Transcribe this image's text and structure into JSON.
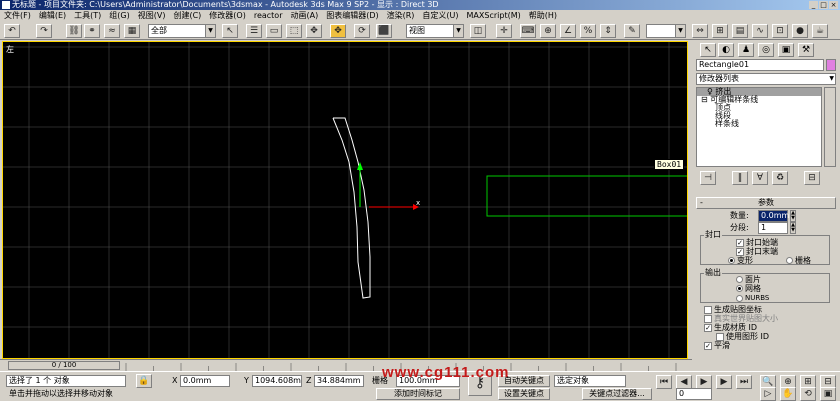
{
  "titlebar": {
    "title": "无标题    - 项目文件夹: C:\\Users\\Administrator\\Documents\\3dsmax    - Autodesk 3ds Max 9 SP2    - 显示 : Direct 3D",
    "buttons": [
      "_",
      "□",
      "×"
    ]
  },
  "menu": [
    "文件(F)",
    "编辑(E)",
    "工具(T)",
    "组(G)",
    "视图(V)",
    "创建(C)",
    "修改器(O)",
    "reactor",
    "动画(A)",
    "图表编辑器(D)",
    "渲染(R)",
    "自定义(U)",
    "MAXScript(M)",
    "帮助(H)"
  ],
  "toolbar": {
    "selection_filter": "全部",
    "coord_system": "视图"
  },
  "viewport": {
    "label": "左",
    "tooltip": "Box01",
    "colors": {
      "grid": "#555555",
      "bg": "#000000",
      "shape": "#ffffff",
      "rect": "#00c800",
      "axis_x": "#ff0000",
      "axis_y": "#00ff00"
    }
  },
  "rightpanel": {
    "object_name": "Rectangle01",
    "modifier_list": "修改器列表",
    "stack": [
      "挤出",
      "可编辑样条线",
      "顶点",
      "线段",
      "样条线"
    ],
    "params_title": "参数",
    "amount_label": "数量:",
    "amount_value": "0.0mm",
    "segments_label": "分段:",
    "segments_value": "1",
    "capping_title": "封口",
    "cap_start": "封口始端",
    "cap_end": "封口末端",
    "morph": "变形",
    "grid": "栅格",
    "output_title": "输出",
    "patch": "面片",
    "mesh": "网格",
    "nurbs": "NURBS",
    "gen_mapping": "生成贴图坐标",
    "real_world": "真实世界贴图大小",
    "gen_matid": "生成材质 ID",
    "use_shape_id": "使用图形 ID",
    "smooth": "平滑"
  },
  "timeline": {
    "slider": "0 / 100"
  },
  "status": {
    "selected": "选择了 1 个 对象",
    "prompt": "单击并拖动以选择并移动对象",
    "x_label": "X",
    "x_value": "0.0mm",
    "y_label": "Y",
    "y_value": "1094.608m",
    "z_label": "Z",
    "z_value": "34.884mm",
    "grid_label": "栅格",
    "grid_value": "100.0mm",
    "add_time_tag": "添加时间标记",
    "auto_key": "自动关键点",
    "set_key": "设置关键点",
    "selected_obj": "选定对象",
    "key_filters": "关键点过滤器...",
    "frame": "0"
  },
  "watermark": "www.cg111.com"
}
